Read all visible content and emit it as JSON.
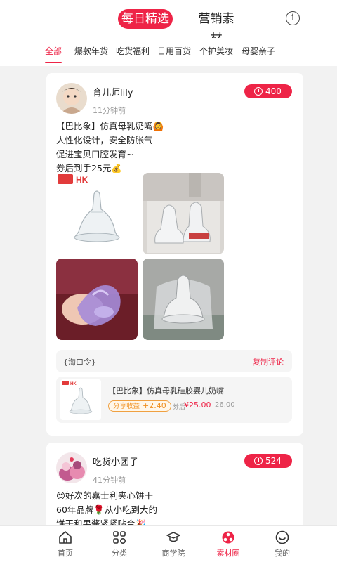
{
  "header": {
    "tabs": [
      {
        "label": "每日精选",
        "active": true
      },
      {
        "label": "营销素材",
        "active": false
      }
    ],
    "info_icon": "info-icon"
  },
  "categories": [
    {
      "label": "全部",
      "active": true
    },
    {
      "label": "爆款年货",
      "active": false
    },
    {
      "label": "吃货福利",
      "active": false
    },
    {
      "label": "日用百货",
      "active": false
    },
    {
      "label": "个护美妆",
      "active": false
    },
    {
      "label": "母婴亲子",
      "active": false
    }
  ],
  "posts": [
    {
      "user": "育儿师lily",
      "time": "11分钟前",
      "count": "400",
      "lines": [
        "【巴比象】仿真母乳奶嘴🙆",
        "人性化设计，安全防胀气",
        "促进宝贝口腔发育~",
        "券后到手25元💰"
      ],
      "tao_label": "{淘口令}",
      "tao_copy": "复制评论",
      "product": {
        "title": "【巴比象】仿真母乳硅胶婴儿奶嘴",
        "share_label": "分享收益",
        "share_value": "+2.40",
        "price_prefix": "券后",
        "price": "¥25.00",
        "original_price": "26.00",
        "brand_text": "HK"
      }
    },
    {
      "user": "吃货小团子",
      "time": "41分钟前",
      "count": "524",
      "lines": [
        "😍好次的嘉士利夹心饼干",
        "60年品牌🌹从小吃到大的",
        "饼干和果酱紧紧贴合🎉"
      ]
    }
  ],
  "tabbar": [
    {
      "label": "首页",
      "icon": "home-icon",
      "active": false
    },
    {
      "label": "分类",
      "icon": "grid-icon",
      "active": false
    },
    {
      "label": "商学院",
      "icon": "graduation-cap-icon",
      "active": false
    },
    {
      "label": "素材圈",
      "icon": "material-circle-icon",
      "active": true
    },
    {
      "label": "我的",
      "icon": "smile-icon",
      "active": false
    }
  ],
  "colors": {
    "accent": "#ee2447",
    "background": "#f2f2f2"
  }
}
